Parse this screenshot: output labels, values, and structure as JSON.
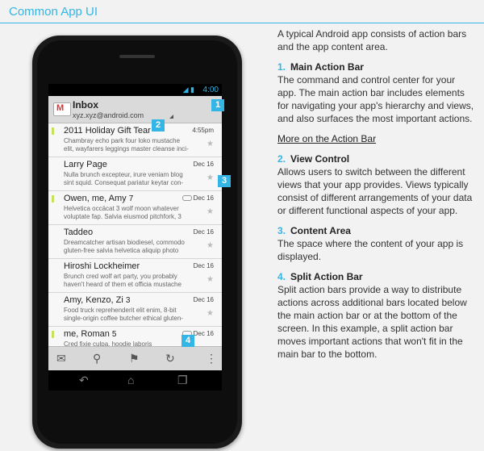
{
  "header": {
    "title": "Common App UI"
  },
  "device": {
    "status_time": "4:00",
    "status_icons": "◢ ▮",
    "action_bar": {
      "title": "Inbox",
      "account": "xyz.xyz@android.com"
    },
    "messages": [
      {
        "from": "2011 Holiday Gift Tear",
        "count": "",
        "date": "4:55pm",
        "snippet": [
          "Chambray echo park four loko mustache",
          "elit, wayfarers leggings master cleanse inci-"
        ],
        "labeled": false,
        "flag": true
      },
      {
        "from": "Larry Page",
        "count": "",
        "date": "Dec 16",
        "snippet": [
          "Nulla brunch excepteur, irure veniam blog",
          "sint squid. Consequat pariatur keytar con-"
        ],
        "labeled": false,
        "flag": false
      },
      {
        "from": "Owen, me, Amy",
        "count": "7",
        "date": "Dec 16",
        "snippet": [
          "Helvetica occäcat 3 wolf moon whatever",
          "voluptate fap. Salvia eiusmod pitchfork, 3"
        ],
        "labeled": true,
        "flag": true
      },
      {
        "from": "Taddeo",
        "count": "",
        "date": "Dec 16",
        "snippet": [
          "Dreamcatcher artisan biodiesel, commodo",
          "gluten-free salvia helvetica aliquip photo"
        ],
        "labeled": false,
        "flag": false
      },
      {
        "from": "Hiroshi Lockheimer",
        "count": "",
        "date": "Dec 16",
        "snippet": [
          "Brunch cred wolf art party, you probably",
          "haven't heard of them et officia mustache"
        ],
        "labeled": false,
        "flag": false
      },
      {
        "from": "Amy, Kenzo, Zi",
        "count": "3",
        "date": "Dec 16",
        "snippet": [
          "Food truck reprehenderit elit enim, 8-bit",
          "single-origin coffee butcher ethical gluten-"
        ],
        "labeled": false,
        "flag": false
      },
      {
        "from": "me, Roman",
        "count": "5",
        "date": "Dec 16",
        "snippet": [
          "Cred fixie culpa, hoodie laboris",
          ""
        ],
        "labeled": true,
        "flag": true
      }
    ],
    "star_glyph": "★",
    "split_bar_icons": [
      "compose-icon",
      "search-icon",
      "labels-icon",
      "refresh-icon",
      "overflow-icon"
    ],
    "nav_icons": [
      "back-icon",
      "home-icon",
      "recents-icon"
    ]
  },
  "callouts": [
    "1",
    "2",
    "3",
    "4"
  ],
  "panel": {
    "intro": "A typical Android app consists of action bars and the app content area.",
    "sections": [
      {
        "num": "1.",
        "title": "Main Action Bar",
        "body": "The command and control center for your app. The main action bar includes elements for navigating your app's hierarchy and views, and also surfaces the most important actions."
      },
      {
        "num": "2.",
        "title": "View Control",
        "body": "Allows users to switch between the different views that your app provides. Views typically consist of different arrangements of your data or different functional aspects of your app."
      },
      {
        "num": "3.",
        "title": "Content Area",
        "body": "The space where the content of your app is displayed."
      },
      {
        "num": "4.",
        "title": "Split Action Bar",
        "body": "Split action bars provide a way to distribute actions across additional bars located below the main action bar or at the bottom of the screen. In this example, a split action bar moves important actions that won't fit in the main bar to the bottom."
      }
    ],
    "more_link": "More on the Action Bar"
  },
  "colors": {
    "accent": "#33b5e5",
    "label_green": "#c6e25b"
  }
}
